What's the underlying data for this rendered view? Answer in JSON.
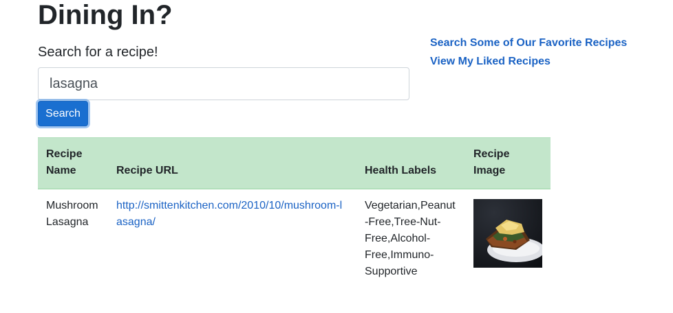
{
  "header": {
    "title": "Dining In?",
    "search_label": "Search for a recipe!"
  },
  "search": {
    "value": "lasagna",
    "button_label": "Search"
  },
  "nav_links": [
    {
      "label": "Search Some of Our Favorite Recipes"
    },
    {
      "label": "View My Liked Recipes"
    }
  ],
  "table": {
    "headers": {
      "name": "Recipe Name",
      "url": "Recipe URL",
      "labels": "Health Labels",
      "image": "Recipe Image"
    },
    "rows": [
      {
        "name": "Mushroom Lasagna",
        "url": "http://smittenkitchen.com/2010/10/mushroom-lasagna/",
        "labels": "Vegetarian,Peanut-Free,Tree-Nut-Free,Alcohol-Free,Immuno-Supportive",
        "image": "lasagna-photo"
      }
    ]
  }
}
